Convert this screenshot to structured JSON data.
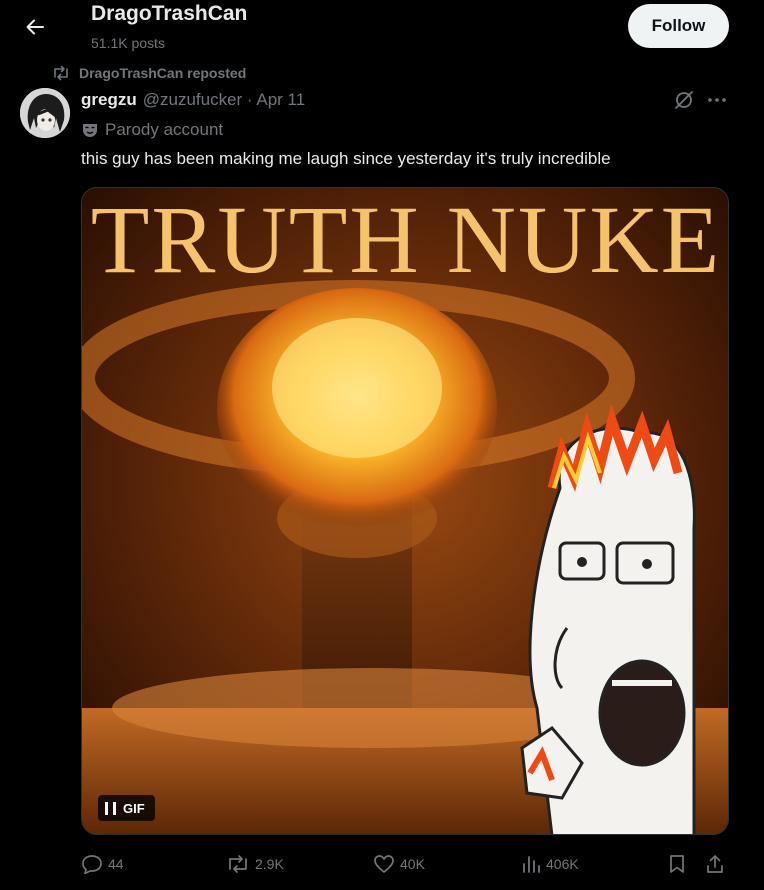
{
  "header": {
    "title": "DragoTrashCan",
    "subtitle": "51.1K posts",
    "follow_label": "Follow",
    "back_icon": "arrow-left-icon"
  },
  "repost": {
    "label": "DragoTrashCan reposted",
    "icon": "repost-icon"
  },
  "post": {
    "author_name": "gregzu",
    "author_meta": "@zuzufucker · Apr 11",
    "parody_label": "Parody account",
    "text": "this guy has been making me laugh since yesterday it's truly incredible",
    "media": {
      "caption": "TRUTH NUKE",
      "badge": "GIF"
    },
    "actions": {
      "replies": "44",
      "reposts": "2.9K",
      "likes": "40K",
      "views": "406K"
    }
  },
  "colors": {
    "background": "#000000",
    "text": "#e7e9ea",
    "muted": "#71767b",
    "follow_bg": "#eff3f4"
  }
}
